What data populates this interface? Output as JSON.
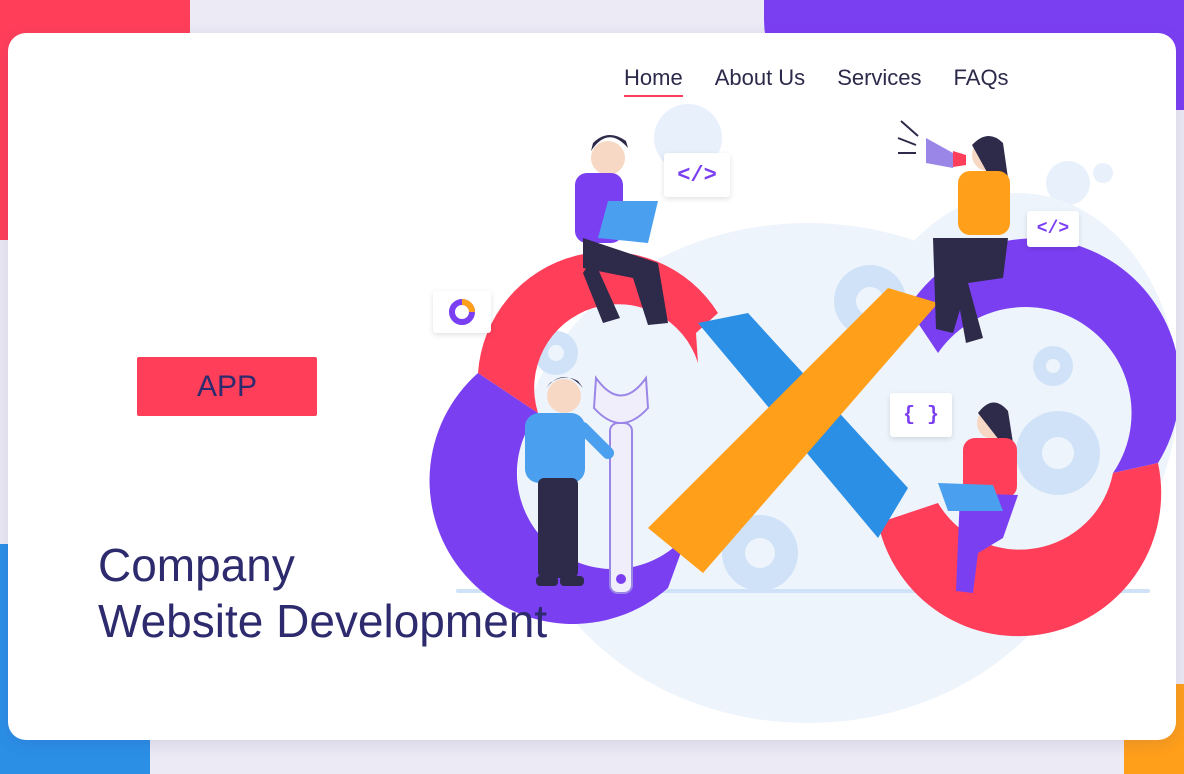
{
  "nav": {
    "items": [
      {
        "label": "Home",
        "active": true
      },
      {
        "label": "About Us",
        "active": false
      },
      {
        "label": "Services",
        "active": false
      },
      {
        "label": "FAQs",
        "active": false
      }
    ]
  },
  "hero": {
    "button_label": "APP",
    "title_line1": "Company",
    "title_line2": "Website Development"
  },
  "illustration": {
    "code_tag_1": "</>",
    "code_tag_2": "</>",
    "code_braces": "{ }"
  },
  "colors": {
    "accent_red": "#ff3f5a",
    "purple": "#7b3ff2",
    "blue": "#2b8fe6",
    "orange": "#ff9f1a",
    "text_dark": "#2d2a6e"
  }
}
